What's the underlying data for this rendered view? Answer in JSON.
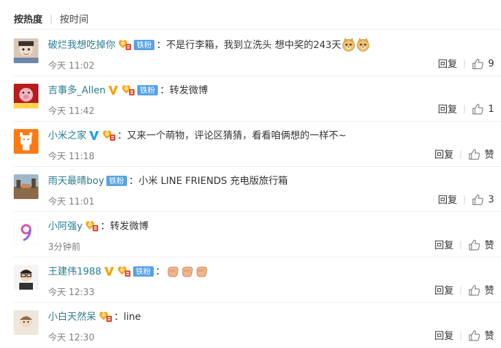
{
  "sort": {
    "hot_label": "按热度",
    "time_label": "按时间"
  },
  "comments": [
    {
      "username": "破烂我想吃掉你",
      "fan_badge": "铁粉",
      "text": "：不是行李箱，我到立洗头 想中奖的243天",
      "time": "今天 11:02",
      "reply_label": "回复",
      "like_label": "9"
    },
    {
      "username": "吉事多_Allen",
      "fan_badge": "铁粉",
      "text": "：转发微博",
      "time": "今天 11:42",
      "reply_label": "回复",
      "like_label": "1"
    },
    {
      "username": "小米之家",
      "text": "：又来一个萌物，评论区猜猜，看看咱俩想的一样不~",
      "time": "今天 11:18",
      "reply_label": "回复",
      "like_label": "赞"
    },
    {
      "username": "雨天最晴boy",
      "fan_badge": "铁粉",
      "text": "：小米 LINE FRIENDS 充电版旅行箱",
      "time": "今天 11:01",
      "reply_label": "回复",
      "like_label": "3"
    },
    {
      "username": "小阿强y",
      "text": "：转发微博",
      "time": "3分钟前",
      "reply_label": "回复",
      "like_label": "赞"
    },
    {
      "username": "王建伟1988",
      "fan_badge": "铁粉",
      "text": "：",
      "time": "今天 12:33",
      "reply_label": "回复",
      "like_label": "赞"
    },
    {
      "username": "小白天然呆",
      "text": "：line",
      "time": "今天 12:30",
      "reply_label": "回复",
      "like_label": "赞"
    }
  ],
  "colors": {
    "username": "#eb7350",
    "fan_badge": "#56a2e8",
    "verified": "#f9a000",
    "time": "#808080"
  }
}
